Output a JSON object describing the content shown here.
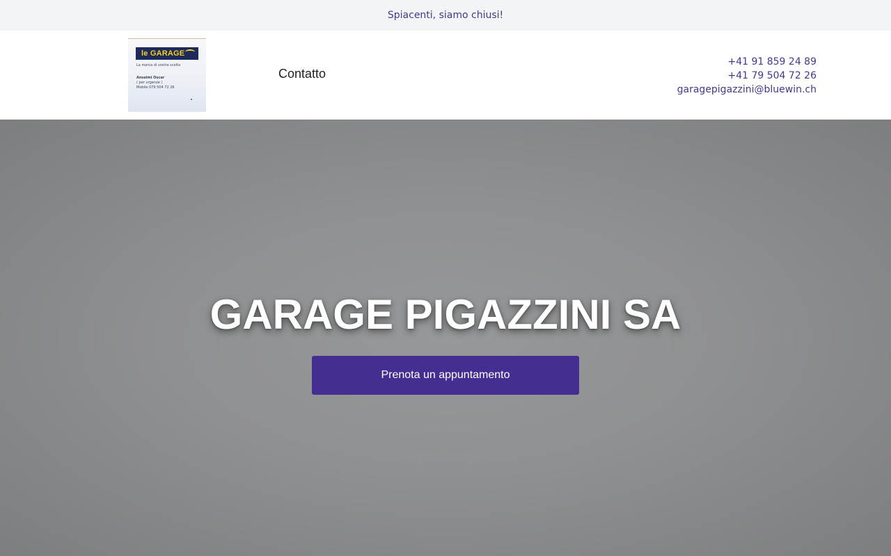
{
  "notice": {
    "text": "Spiacenti, siamo chiusi!"
  },
  "header": {
    "logo": {
      "badge_text": "le GARAGE",
      "tagline": "La marca di vostra scelta",
      "name": "Anselmi Oscar",
      "urgent": "( per urgenze )",
      "mobile": "Mobile 079 504 72 26"
    },
    "nav": {
      "contact_label": "Contatto"
    },
    "contacts": {
      "phone1": "+41 91 859 24 89",
      "phone2": "+41 79 504 72 26",
      "email": "garagepigazzini@bluewin.ch"
    }
  },
  "hero": {
    "title": "GARAGE PIGAZZINI SA",
    "cta_label": "Prenota un appuntamento"
  },
  "colors": {
    "accent": "#452e92",
    "link": "#3f3a8c",
    "notice_bg": "#f3f4f6",
    "hero_bg": "#8f9091"
  }
}
